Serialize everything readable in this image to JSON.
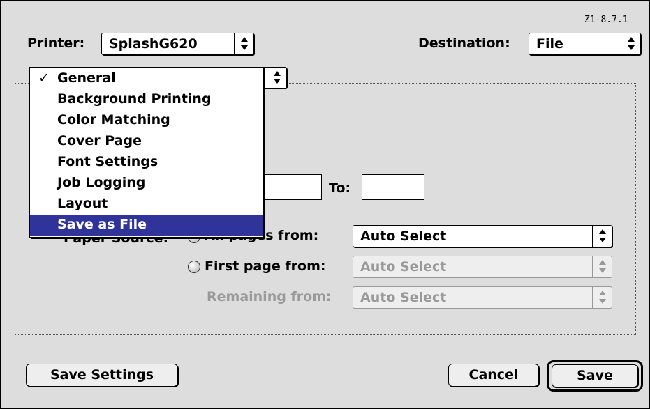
{
  "version": "Z1-8.7.1",
  "printer": {
    "label": "Printer:",
    "value": "SplashG620"
  },
  "destination": {
    "label": "Destination:",
    "value": "File"
  },
  "pages": {
    "to_label": "To:"
  },
  "paper_source": {
    "label_fragment_left": "Paper Source:",
    "all_pages_label": "All pages from:",
    "all_pages_value": "Auto Select",
    "first_page_label": "First page from:",
    "first_page_value": "Auto Select",
    "remaining_label": "Remaining from:",
    "remaining_value": "Auto Select"
  },
  "menu": {
    "checkmark": "✓",
    "items": [
      {
        "label": "General",
        "checked": true
      },
      {
        "label": "Background Printing"
      },
      {
        "label": "Color Matching"
      },
      {
        "label": "Cover Page"
      },
      {
        "label": "Font Settings"
      },
      {
        "label": "Job Logging"
      },
      {
        "label": "Layout"
      },
      {
        "label": "Save as File",
        "highlighted": true
      }
    ]
  },
  "buttons": {
    "save_settings": "Save Settings",
    "cancel": "Cancel",
    "save": "Save"
  },
  "colors": {
    "dialog_bg": "#dddddd",
    "menu_highlight": "#303399",
    "disabled_text": "#999999"
  },
  "icons": {
    "popup_arrows": "updown-arrows-icon",
    "radio": "radio-button-icon"
  }
}
